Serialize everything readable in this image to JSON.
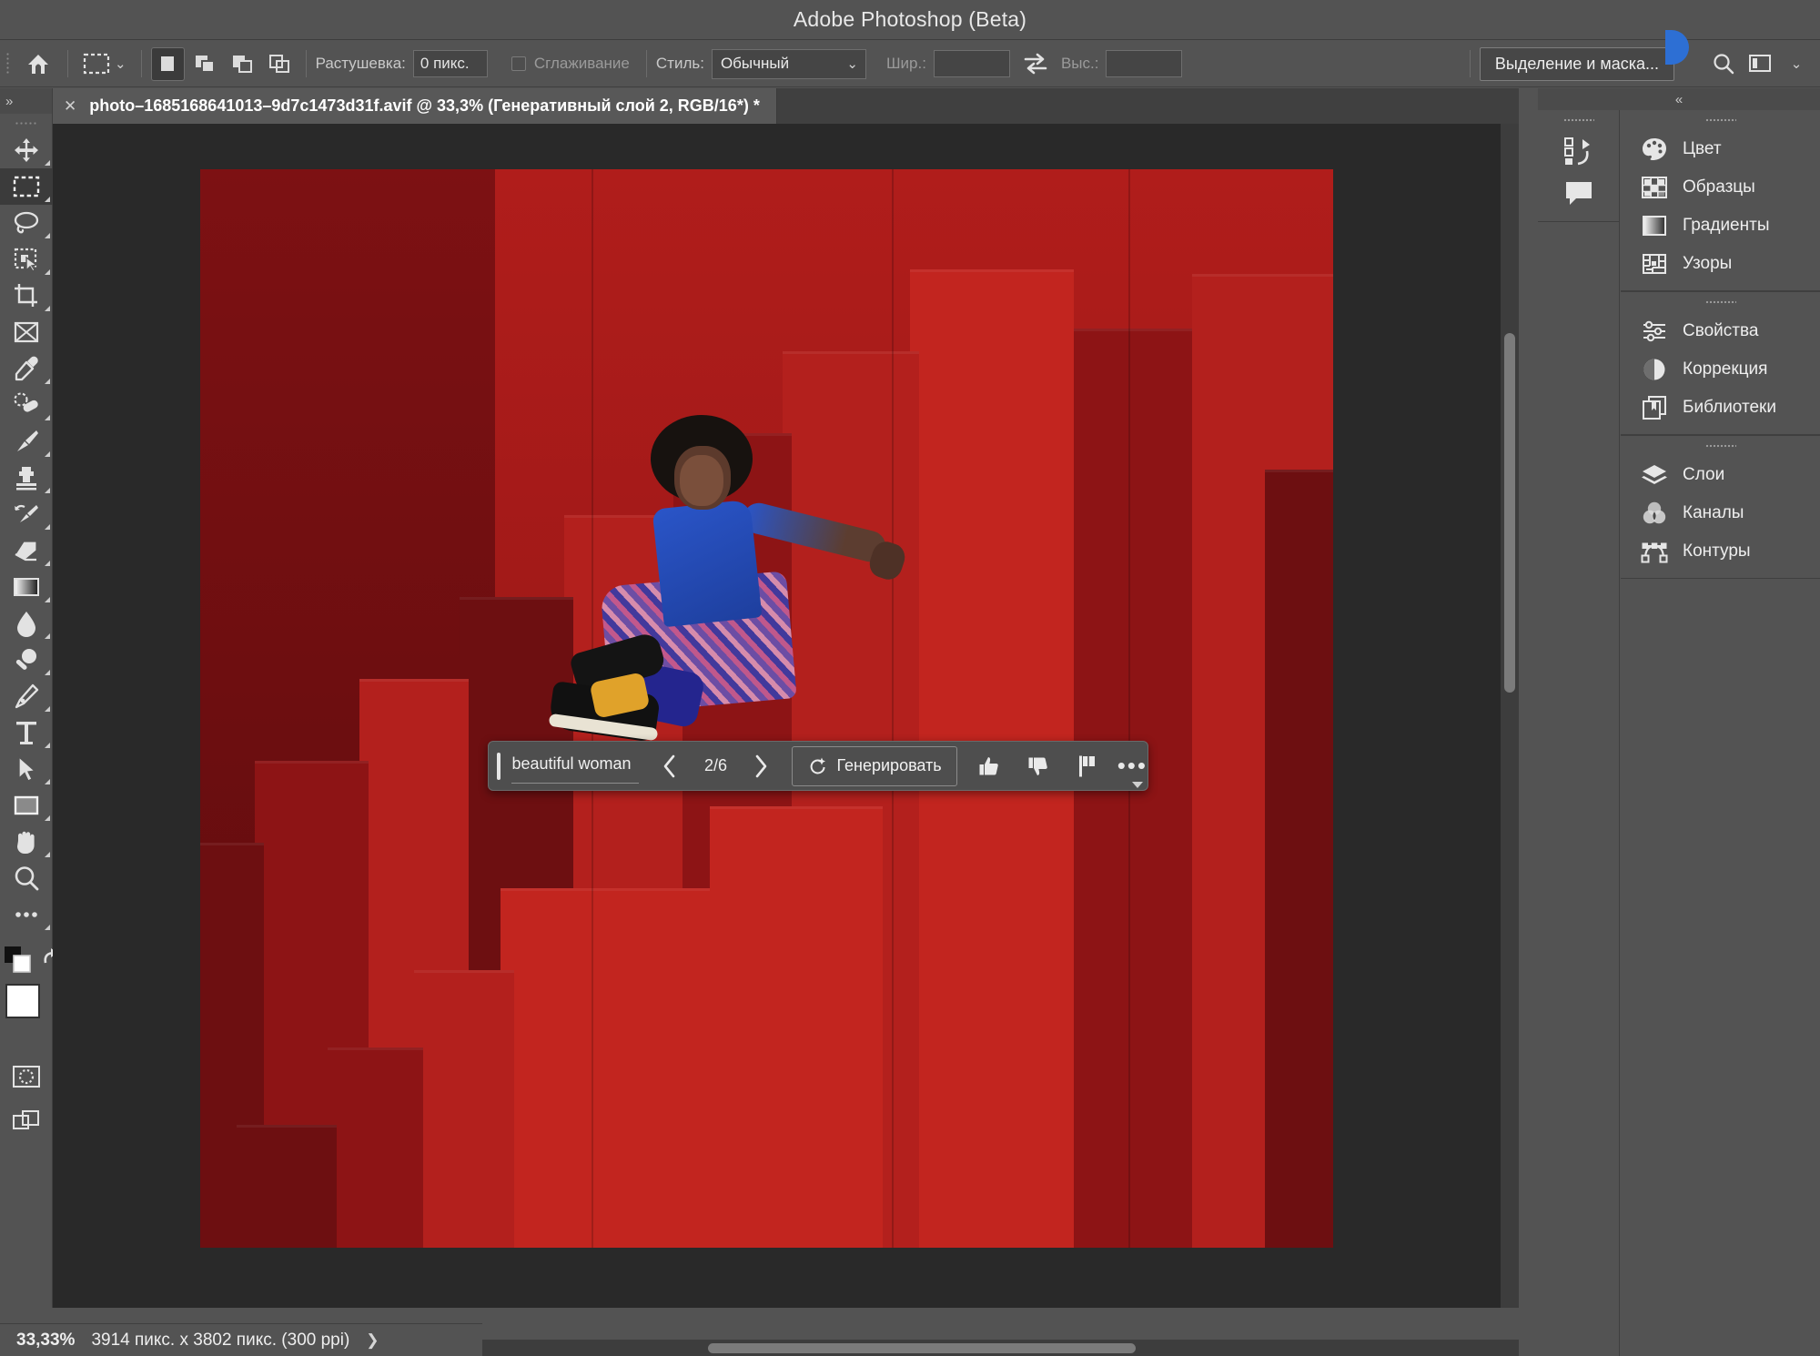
{
  "window": {
    "title": "Adobe Photoshop (Beta)"
  },
  "options_bar": {
    "home_icon": "home-icon",
    "tool_icon": "rectangular-marquee-icon",
    "tool_dropdown_chevron": "chevron-down-icon",
    "selection_modes": [
      {
        "name": "new-selection",
        "icon": "new-selection-icon",
        "active": true
      },
      {
        "name": "add-to-selection",
        "icon": "add-to-selection-icon",
        "active": false
      },
      {
        "name": "subtract-from-selection",
        "icon": "subtract-from-selection-icon",
        "active": false
      },
      {
        "name": "intersect-selection",
        "icon": "intersect-selection-icon",
        "active": false
      }
    ],
    "feather_label": "Растушевка:",
    "feather_value": "0 пикс.",
    "antialias_label": "Сглаживание",
    "antialias_checked": false,
    "style_label": "Стиль:",
    "style_value": "Обычный",
    "width_label": "Шир.:",
    "width_value": "",
    "swap_icon": "swap-arrows-icon",
    "height_label": "Выс.:",
    "height_value": "",
    "select_and_mask_label": "Выделение и маска...",
    "search_icon": "search-icon",
    "workspace_icon": "workspace-icon",
    "workspace_chevron": "chevron-down-icon"
  },
  "toolbar": {
    "collapse_label": "»",
    "tools": [
      {
        "name": "move-tool",
        "icon": "move-icon",
        "active": false,
        "has_flyout": true
      },
      {
        "name": "rectangular-marquee-tool",
        "icon": "marquee-icon",
        "active": true,
        "has_flyout": true
      },
      {
        "name": "lasso-tool",
        "icon": "lasso-icon",
        "active": false,
        "has_flyout": true
      },
      {
        "name": "object-selection-tool",
        "icon": "object-selection-icon",
        "active": false,
        "has_flyout": true
      },
      {
        "name": "crop-tool",
        "icon": "crop-icon",
        "active": false,
        "has_flyout": true
      },
      {
        "name": "frame-tool",
        "icon": "frame-icon",
        "active": false,
        "has_flyout": false
      },
      {
        "name": "eyedropper-tool",
        "icon": "eyedropper-icon",
        "active": false,
        "has_flyout": true
      },
      {
        "name": "healing-brush-tool",
        "icon": "healing-brush-icon",
        "active": false,
        "has_flyout": true
      },
      {
        "name": "brush-tool",
        "icon": "brush-icon",
        "active": false,
        "has_flyout": true
      },
      {
        "name": "clone-stamp-tool",
        "icon": "clone-stamp-icon",
        "active": false,
        "has_flyout": true
      },
      {
        "name": "history-brush-tool",
        "icon": "history-brush-icon",
        "active": false,
        "has_flyout": true
      },
      {
        "name": "eraser-tool",
        "icon": "eraser-icon",
        "active": false,
        "has_flyout": true
      },
      {
        "name": "gradient-tool",
        "icon": "gradient-icon",
        "active": false,
        "has_flyout": true
      },
      {
        "name": "blur-tool",
        "icon": "blur-drop-icon",
        "active": false,
        "has_flyout": true
      },
      {
        "name": "dodge-tool",
        "icon": "dodge-icon",
        "active": false,
        "has_flyout": true
      },
      {
        "name": "pen-tool",
        "icon": "pen-icon",
        "active": false,
        "has_flyout": true
      },
      {
        "name": "type-tool",
        "icon": "type-icon",
        "active": false,
        "has_flyout": true
      },
      {
        "name": "path-selection-tool",
        "icon": "path-selection-arrow-icon",
        "active": false,
        "has_flyout": true
      },
      {
        "name": "rectangle-tool",
        "icon": "rectangle-shape-icon",
        "active": false,
        "has_flyout": true
      },
      {
        "name": "hand-tool",
        "icon": "hand-icon",
        "active": false,
        "has_flyout": true
      },
      {
        "name": "zoom-tool",
        "icon": "zoom-magnifier-icon",
        "active": false,
        "has_flyout": false
      },
      {
        "name": "edit-toolbar-tool",
        "icon": "ellipsis-icon",
        "active": false,
        "has_flyout": true
      }
    ],
    "foreground_color": "#ffffff",
    "background_color": "#ffffff",
    "swap_colors_icon": "swap-colors-icon",
    "default_colors_icon": "default-colors-icon",
    "quick_mask_icon": "quick-mask-icon",
    "screen_mode_icon": "screen-mode-icon"
  },
  "document": {
    "close_icon": "close-icon",
    "tab_title": "photo–1685168641013–9d7c1473d31f.avif @ 33,3% (Генеративный слой 2, RGB/16*) *"
  },
  "generative_bar": {
    "prompt_value": "beautiful woman",
    "prompt_placeholder": "beautiful woman",
    "prev_icon": "chevron-left-icon",
    "variation_count": "2/6",
    "next_icon": "chevron-right-icon",
    "generate_label": "Генерировать",
    "generate_icon": "sparkle-refresh-icon",
    "thumbs_up_icon": "thumbs-up-icon",
    "thumbs_down_icon": "thumbs-down-icon",
    "flag_icon": "flag-icon",
    "more_icon": "ellipsis-icon"
  },
  "panels": {
    "collapse_label": "«",
    "narrow_rail": [
      {
        "name": "history-panel",
        "icon": "history-icon"
      },
      {
        "name": "comments-panel",
        "icon": "comment-bubble-icon"
      }
    ],
    "groups": [
      {
        "items": [
          {
            "name": "color-panel",
            "label": "Цвет",
            "icon": "palette-icon"
          },
          {
            "name": "swatches-panel",
            "label": "Образцы",
            "icon": "swatches-grid-icon"
          },
          {
            "name": "gradients-panel",
            "label": "Градиенты",
            "icon": "gradient-square-icon"
          },
          {
            "name": "patterns-panel",
            "label": "Узоры",
            "icon": "pattern-icon"
          }
        ]
      },
      {
        "items": [
          {
            "name": "properties-panel",
            "label": "Свойства",
            "icon": "sliders-icon"
          },
          {
            "name": "adjustments-panel",
            "label": "Коррекция",
            "icon": "half-circle-icon"
          },
          {
            "name": "libraries-panel",
            "label": "Библиотеки",
            "icon": "libraries-icon"
          }
        ]
      },
      {
        "items": [
          {
            "name": "layers-panel",
            "label": "Слои",
            "icon": "layers-stack-icon"
          },
          {
            "name": "channels-panel",
            "label": "Каналы",
            "icon": "channels-venn-icon"
          },
          {
            "name": "paths-panel",
            "label": "Контуры",
            "icon": "paths-curve-icon"
          }
        ]
      }
    ]
  },
  "status_bar": {
    "zoom": "33,33%",
    "dimensions": "3914 пикс. x 3802 пикс. (300 ppi)",
    "expand_icon": "chevron-right-icon"
  },
  "colors": {
    "chrome": "#535353",
    "canvas": "#292929",
    "accent_blue": "#2d6fd4",
    "panel_text": "#eeeeee"
  }
}
